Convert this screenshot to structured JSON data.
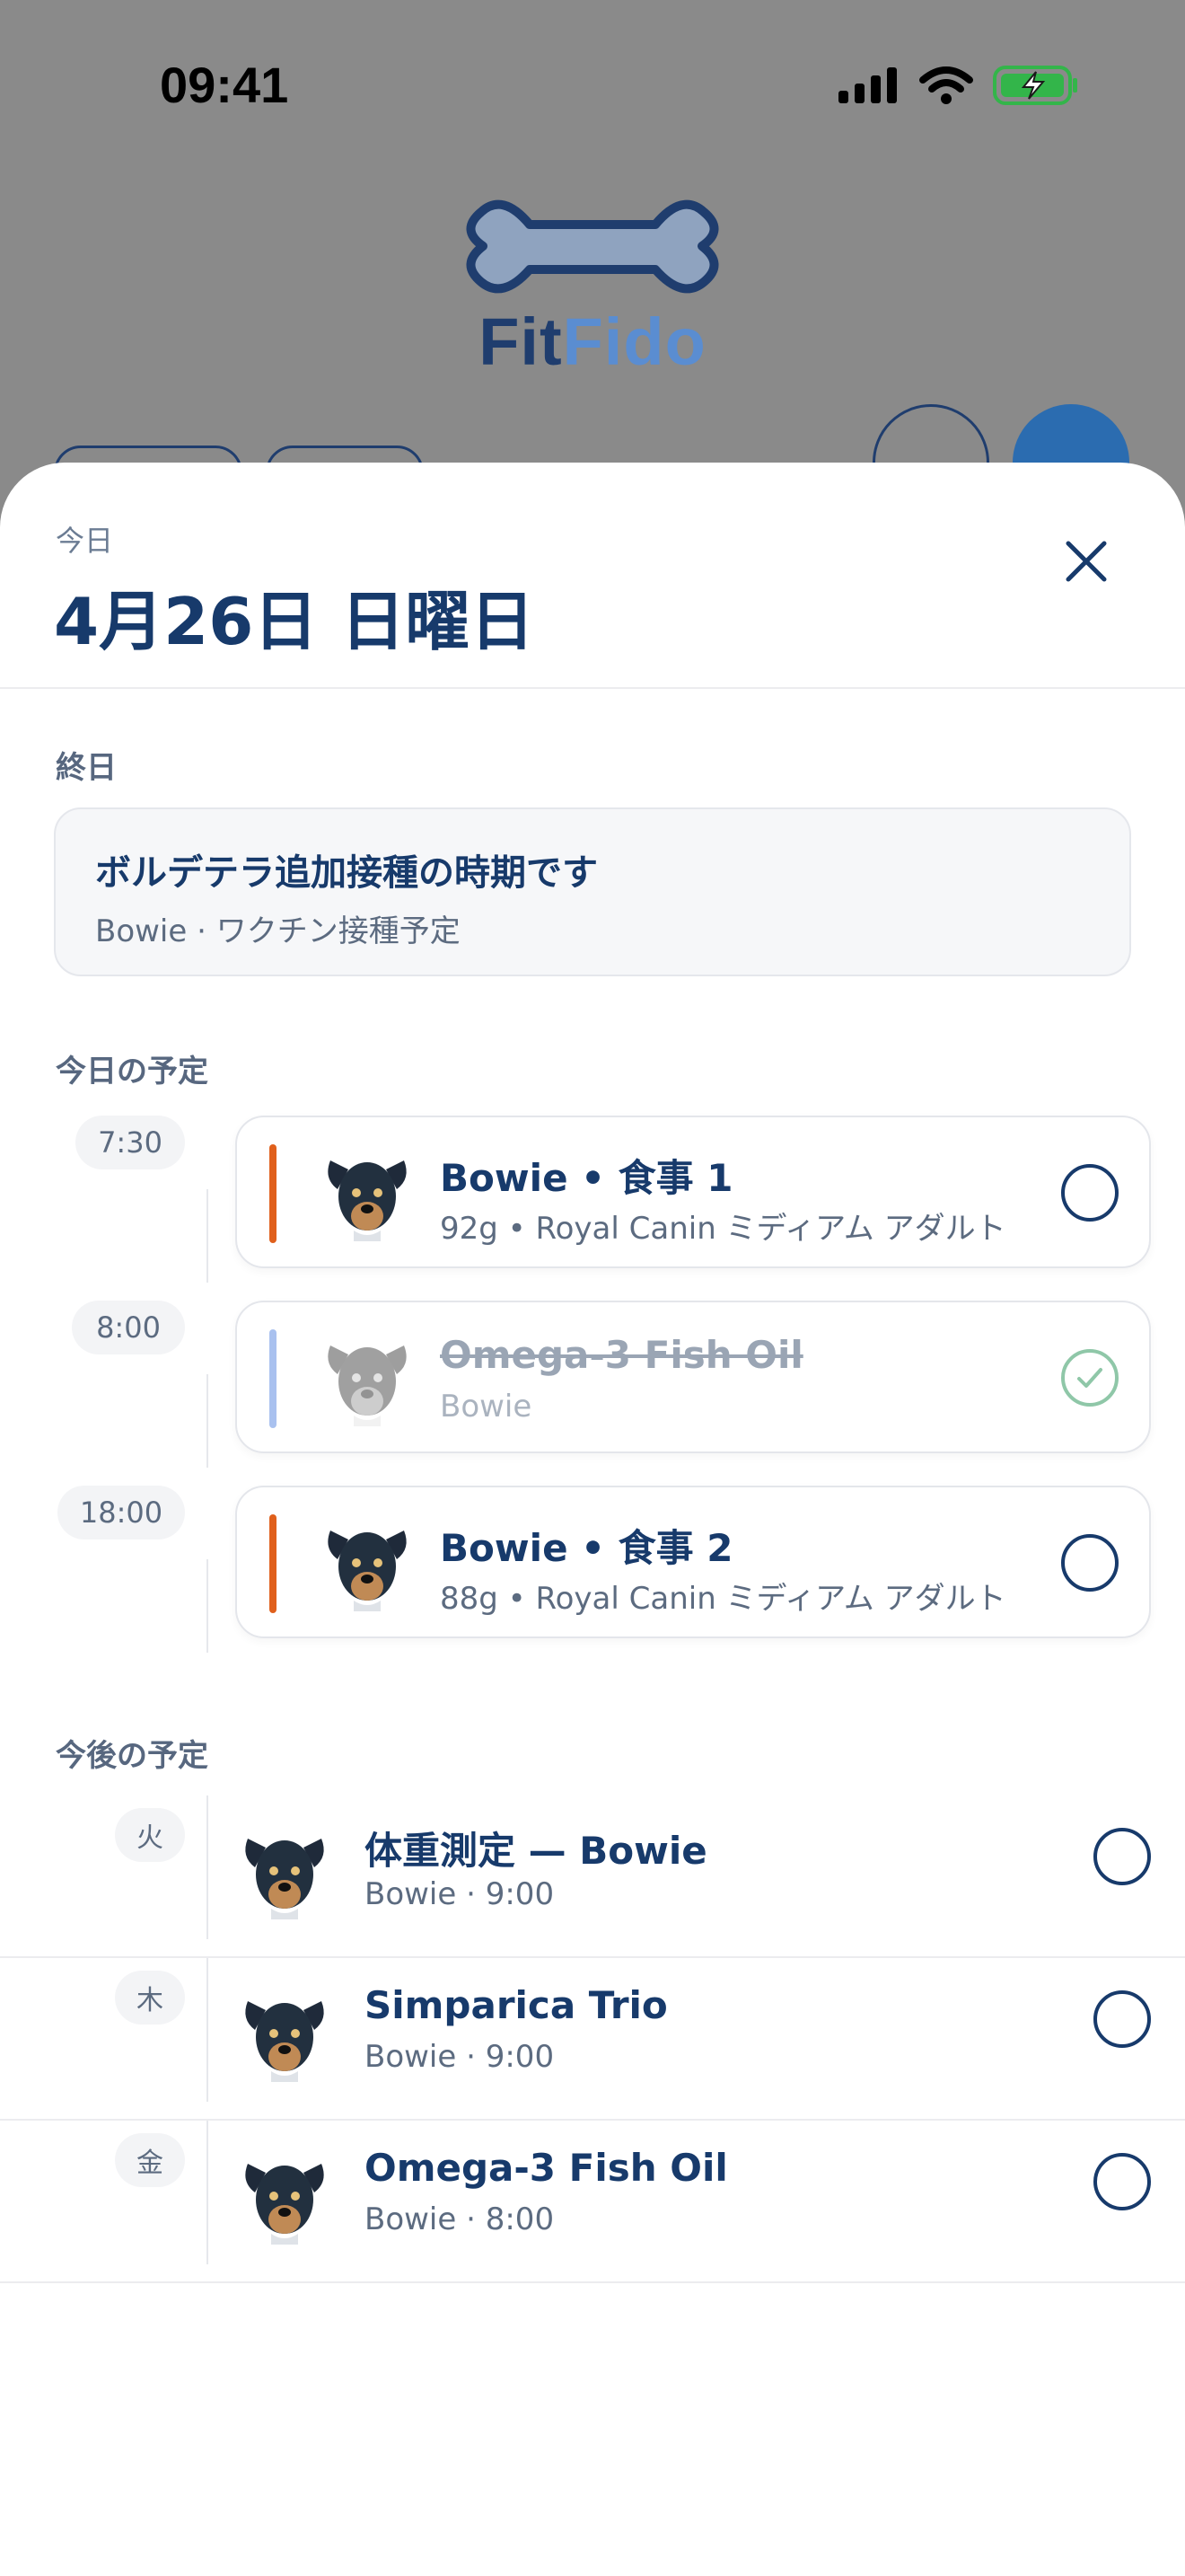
{
  "status_bar": {
    "time": "09:41",
    "icons": [
      "cellular-signal-icon",
      "wifi-icon",
      "battery-charging-icon"
    ]
  },
  "app": {
    "logo_part1": "Fit",
    "logo_part2": "Fido",
    "brand_color": "#1f3d6e",
    "accent_color": "#5a8dd1"
  },
  "sheet": {
    "today_label": "今日",
    "date_title": "4月26日 日曜日",
    "allday_section": "終日",
    "allday_event": {
      "title": "ボルデテラ追加接種の時期です",
      "subtitle": "Bowie · ワクチン接種予定"
    },
    "today_section": "今日の予定",
    "today_items": [
      {
        "time": "7:30",
        "title": "Bowie • 食事 1",
        "subtitle": "92g • Royal Canin ミディアム アダルト",
        "bar_color": "#e0601c",
        "done": false
      },
      {
        "time": "8:00",
        "title": "Omega-3 Fish Oil",
        "subtitle": "Bowie",
        "bar_color": "#a9c1ef",
        "done": true
      },
      {
        "time": "18:00",
        "title": "Bowie • 食事 2",
        "subtitle": "88g • Royal Canin ミディアム アダルト",
        "bar_color": "#e0601c",
        "done": false
      }
    ],
    "upcoming_section": "今後の予定",
    "upcoming_items": [
      {
        "day": "火",
        "title": "体重測定 — Bowie",
        "subtitle": "Bowie · 9:00"
      },
      {
        "day": "木",
        "title": "Simparica Trio",
        "subtitle": "Bowie · 9:00"
      },
      {
        "day": "金",
        "title": "Omega-3 Fish Oil",
        "subtitle": "Bowie · 8:00"
      }
    ]
  }
}
